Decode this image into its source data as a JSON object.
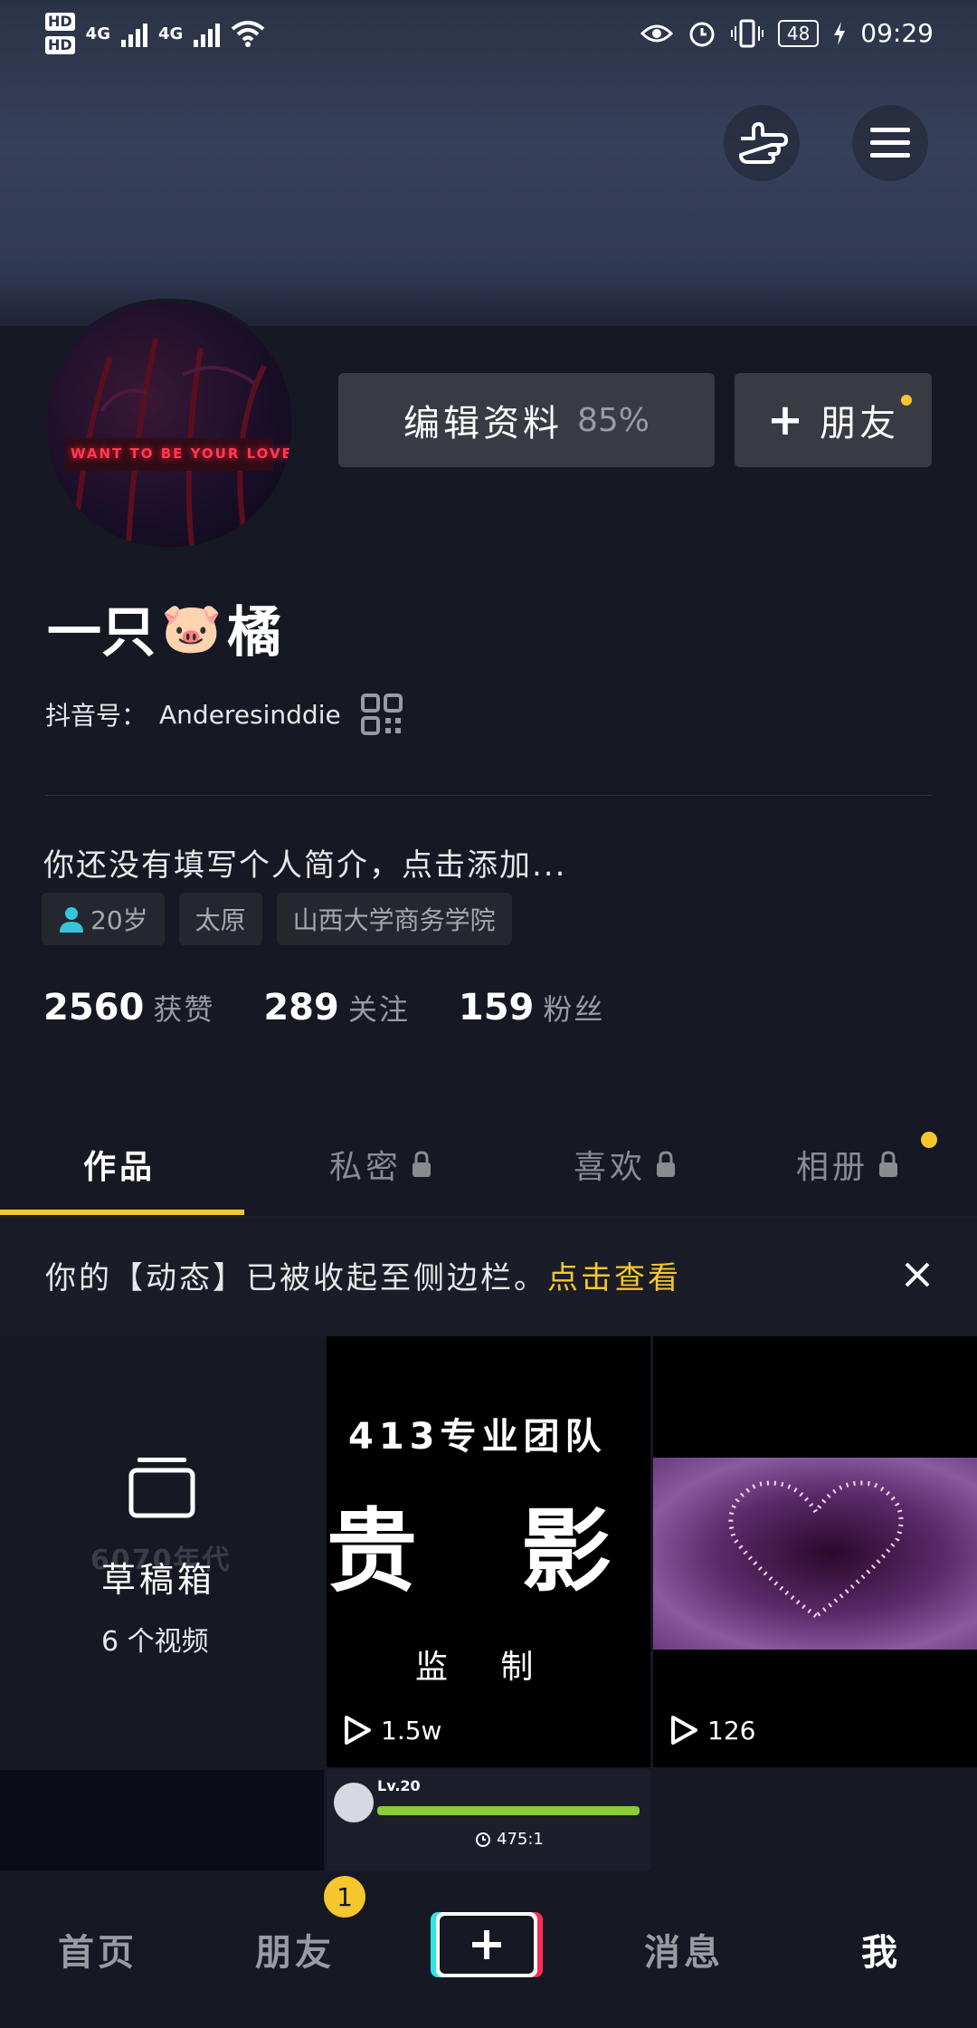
{
  "status_bar": {
    "network_1": "4G",
    "network_2": "4G",
    "battery": "48",
    "time": "09:29",
    "hd_1": "HD",
    "hd_2": "HD"
  },
  "profile": {
    "name_part1": "一只",
    "name_emoji": "🐷",
    "name_part2": "橘",
    "account_label": "抖音号：",
    "account_id": "Anderesinddie",
    "bio": "你还没有填写个人简介，点击添加...",
    "tags": [
      "20岁",
      "太原",
      "山西大学商务学院"
    ],
    "avatar_text_1": "WANT TO BE YOUR LOVE"
  },
  "actions": {
    "edit_label": "编辑资料",
    "edit_percent": "85%",
    "add_friend_label": "朋友"
  },
  "stats": [
    {
      "num": "2560",
      "label": "获赞"
    },
    {
      "num": "289",
      "label": "关注"
    },
    {
      "num": "159",
      "label": "粉丝"
    }
  ],
  "tabs": [
    {
      "label": "作品"
    },
    {
      "label": "私密"
    },
    {
      "label": "喜欢"
    },
    {
      "label": "相册"
    }
  ],
  "notice": {
    "text": "你的【动态】已被收起至侧边栏。",
    "link": "点击查看"
  },
  "grid": {
    "drafts_watermark": "6070年代",
    "drafts_label": "草稿箱",
    "drafts_count": "6 个视频",
    "video1_line1": "413专业团队",
    "video1_line2": "贵 影",
    "video1_line3": "监   制",
    "video1_plays": "1.5w",
    "video2_plays": "126",
    "game_level": "Lv.20",
    "game_timer": "475:1"
  },
  "bottom_nav": {
    "home": "首页",
    "friends": "朋友",
    "friends_badge": "1",
    "messages": "消息",
    "me": "我"
  },
  "colors": {
    "background": "#161823",
    "accent": "#f6c62e",
    "tiktok_cyan": "#2ee6e6",
    "tiktok_red": "#fe2c55"
  }
}
